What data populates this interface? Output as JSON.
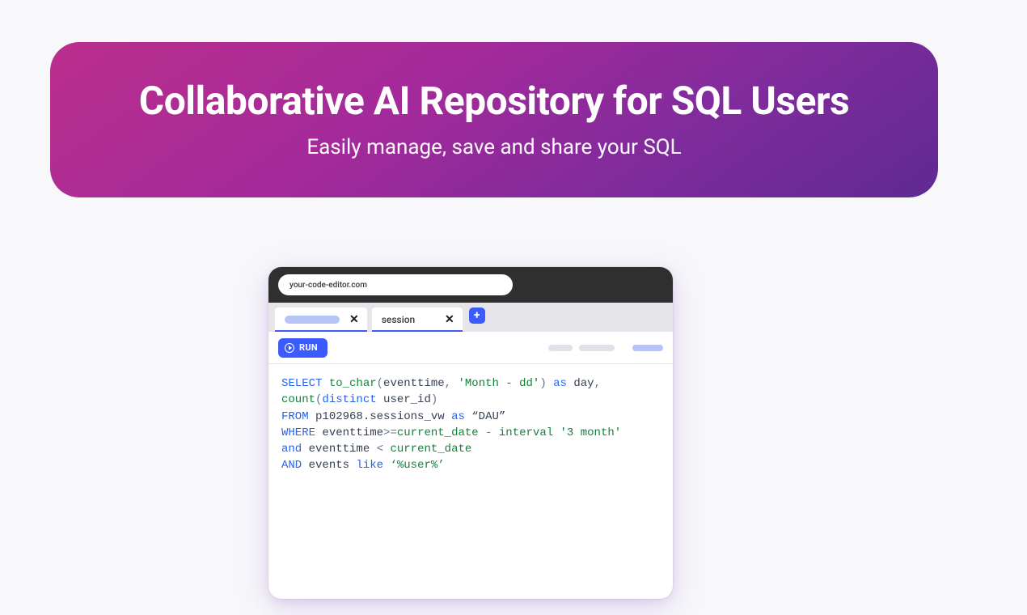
{
  "hero": {
    "title": "Collaborative AI Repository for SQL Users",
    "subtitle": "Easily manage, save and share your SQL"
  },
  "editor": {
    "url": "your-code-editor.com",
    "tabs": {
      "tab1_label_placeholder": true,
      "tab2_label": "session"
    },
    "add_tab_glyph": "+",
    "close_glyph": "✕",
    "toolbar": {
      "run_label": "RUN"
    },
    "code": {
      "tokens": [
        {
          "t": "SELECT",
          "c": "kw"
        },
        {
          "t": " "
        },
        {
          "t": "to_char",
          "c": "fn"
        },
        {
          "t": "(",
          "c": "punc"
        },
        {
          "t": "eventtime",
          "c": "id"
        },
        {
          "t": ", ",
          "c": "punc"
        },
        {
          "t": "'Month - dd'",
          "c": "str"
        },
        {
          "t": ")",
          "c": "punc"
        },
        {
          "t": " "
        },
        {
          "t": "as",
          "c": "kw"
        },
        {
          "t": " "
        },
        {
          "t": "day",
          "c": "id"
        },
        {
          "t": ", ",
          "c": "punc"
        },
        {
          "t": "count",
          "c": "fn"
        },
        {
          "t": "(",
          "c": "punc"
        },
        {
          "t": "distinct",
          "c": "kw"
        },
        {
          "t": " "
        },
        {
          "t": "user_id",
          "c": "id"
        },
        {
          "t": ")",
          "c": "punc"
        },
        {
          "t": "\n"
        },
        {
          "t": "FROM",
          "c": "kw"
        },
        {
          "t": " "
        },
        {
          "t": "p102968.sessions_vw",
          "c": "id"
        },
        {
          "t": " "
        },
        {
          "t": "as",
          "c": "kw"
        },
        {
          "t": " "
        },
        {
          "t": "“DAU”",
          "c": "id"
        },
        {
          "t": "\n"
        },
        {
          "t": "WHERE",
          "c": "kw"
        },
        {
          "t": " "
        },
        {
          "t": "eventtime",
          "c": "id"
        },
        {
          "t": ">=",
          "c": "punc"
        },
        {
          "t": "current_date",
          "c": "fn"
        },
        {
          "t": " - ",
          "c": "punc"
        },
        {
          "t": "interval",
          "c": "fn"
        },
        {
          "t": " "
        },
        {
          "t": "'3 month'",
          "c": "str"
        },
        {
          "t": "\n"
        },
        {
          "t": "and",
          "c": "kw"
        },
        {
          "t": " "
        },
        {
          "t": "eventtime",
          "c": "id"
        },
        {
          "t": " < ",
          "c": "punc"
        },
        {
          "t": "current_date",
          "c": "fn"
        },
        {
          "t": "\n"
        },
        {
          "t": "AND",
          "c": "kw"
        },
        {
          "t": " "
        },
        {
          "t": "events",
          "c": "id"
        },
        {
          "t": " "
        },
        {
          "t": "like",
          "c": "kw"
        },
        {
          "t": " "
        },
        {
          "t": "‘%user%’",
          "c": "str"
        }
      ]
    }
  }
}
